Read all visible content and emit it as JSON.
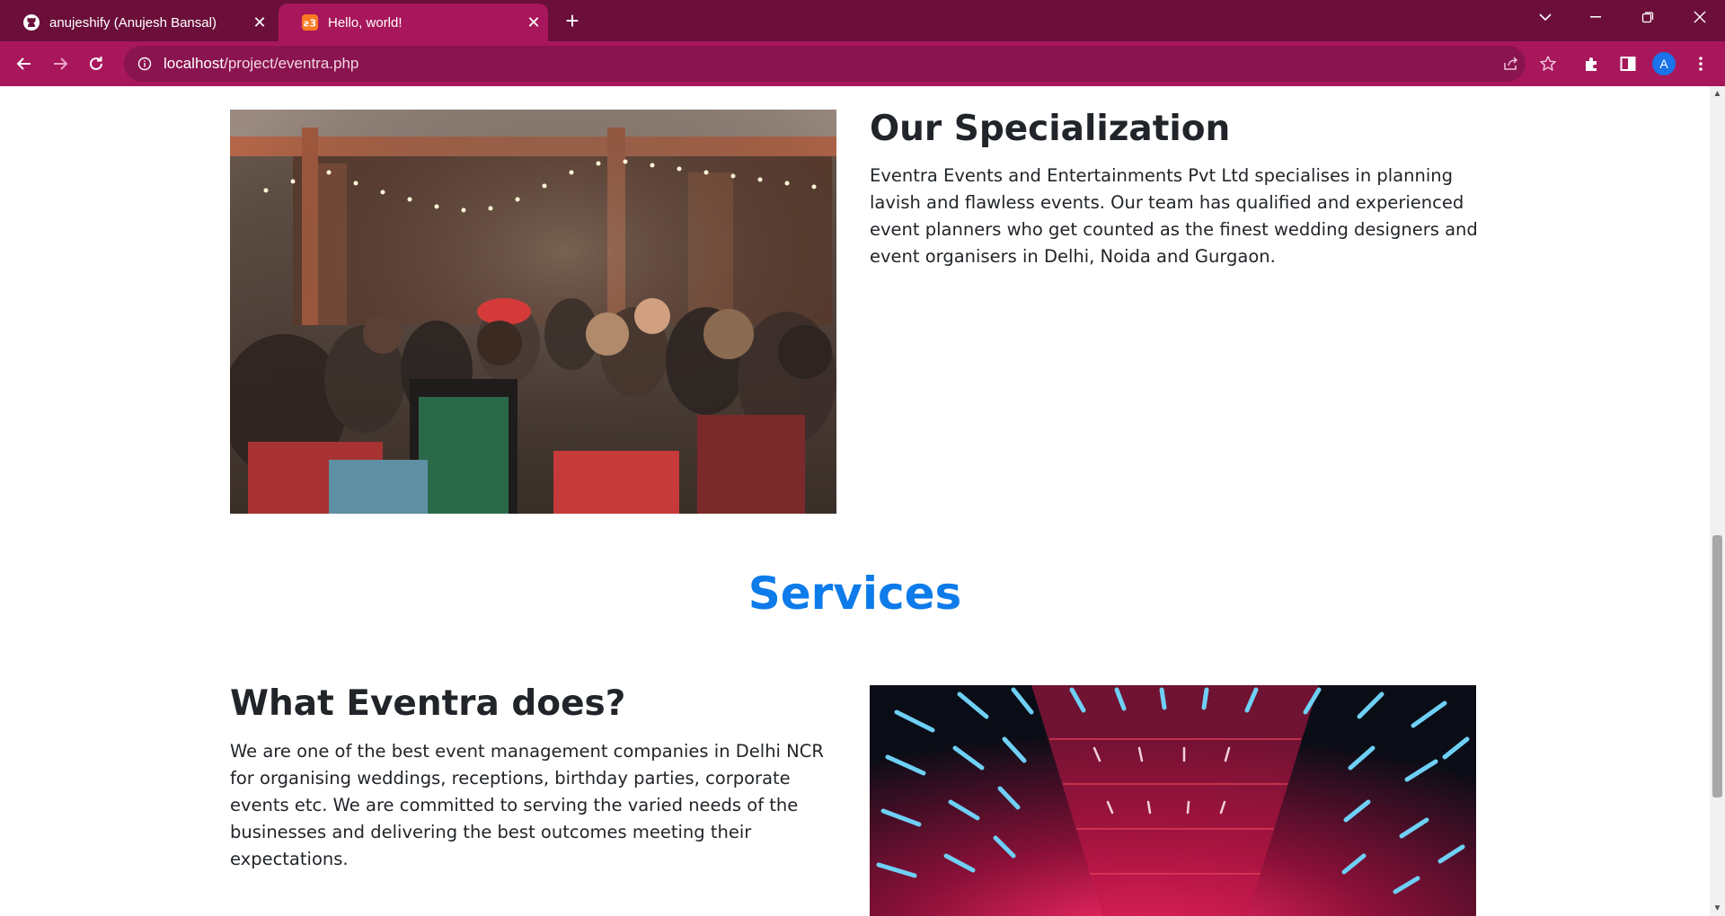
{
  "browser": {
    "tabs": [
      {
        "title": "anujeshify (Anujesh Bansal)",
        "icon": "github-icon",
        "active": false
      },
      {
        "title": "Hello, world!",
        "icon": "xampp-icon",
        "active": true
      }
    ],
    "url_host": "localhost",
    "url_path": "/project/eventra.php",
    "profile_initial": "A",
    "colors": {
      "tabbar": "#6b0f3a",
      "toolbar": "#a8175b",
      "omnibox": "#8a1450"
    }
  },
  "specialization": {
    "heading": "Our Specialization",
    "text": "Eventra Events and Entertainments Pvt Ltd specialises in planning lavish and flawless events. Our team has qualified and experienced event planners who get counted as the finest wedding designers and event organisers in Delhi, Noida and Gurgaon."
  },
  "services": {
    "title": "Services",
    "title_color": "#0d7bea",
    "what_heading": "What Eventra does?",
    "what_text": "We are one of the best event management companies in Delhi NCR for organising weddings, receptions, birthday parties, corporate events etc. We are committed to serving the varied needs of the businesses and delivering the best outcomes meeting their expectations."
  }
}
